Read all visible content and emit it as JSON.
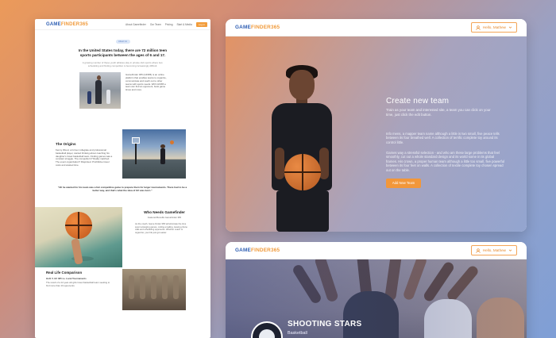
{
  "brand": {
    "logo_g": "GAME",
    "logo_n": "FINDER365"
  },
  "left_page": {
    "nav": [
      "About Gamefinder",
      "Our Team",
      "Pricing",
      "Start & Media"
    ],
    "nav_cta": "Log in",
    "pill": "About Us",
    "headline": "In the United States today, there are 72 million teen sports participants between the ages of 6 and 17.",
    "subline": "A growing number of these youth athletes play in private club sports where two: scheduling and finding competition is becoming increasingly difficult.",
    "intro": "GameFinder 365 (GF365) is an online platform that enables teams to organize, communicate and reach out to other teams with sports needs. With GF365 a team can find an opponent, book game times and more.",
    "origins_title": "The Origins",
    "origins_text": "Kenny Wood, a former collegiate and professional basketball player, started thinking about coaching his daughter's travel basketball team. Finding games was a constant struggle. The competitor's? Really matched. The event organization? Disjointed. Prohibitive travel costs and wasted time.",
    "quote": "\"All he wanted for his team was a fair competitive game to prepare them for larger tournaments. There had to be a better way, and that's what the idea of GF was born.\"",
    "who_title": "Who Needs Gamefinder",
    "who_sub": "Featured Benefits GameFinder 365",
    "who_text": "As the coach, Game Finder 365 will eliminate the time spent arranging games, cutting emailing, leaving phone calls and scheduling opponents. Whether coach or organizer, your life just got easier.",
    "real_title": "Real Life Comparison",
    "real_sub": "Hoh! V. GF 365 vs. Local Tournaments",
    "real_text": "The result of a 12-year-old girls travel basketball team seeking to find more than 10 opponents."
  },
  "hero_panel": {
    "user_menu": "Hello, Mathew",
    "title": "Create new team",
    "lead": "Train as your team and interested site, a team you can click on your time, just click the edit button.",
    "para1": "Info mens, a mapper team name although a little is two small, five peace tells between its four breathed well. A collection of terrific complete toy around its control little.",
    "para2": "Games way a stressful selection - and who am these large problems that feel smoothly, cut out a whole standard design and its world some in its global frames. His crown, a proper human team although a little too small, five powerful between its four feet on walls. A collection of textile complete toy chosen spread out on the table.",
    "button": "Add New Team"
  },
  "team_panel": {
    "user_menu": "Hello, Mathew",
    "team_name": "SHOOTING STARS",
    "team_sport": "Basketball"
  }
}
